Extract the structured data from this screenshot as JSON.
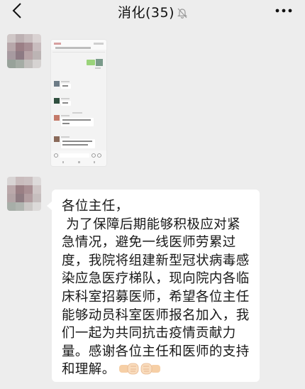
{
  "header": {
    "title": "消化(35)"
  },
  "messages": [
    {
      "type": "image",
      "content": "chat-screenshot-thumbnail"
    },
    {
      "type": "text",
      "text": "各位主任，\n 为了保障后期能够积极应对紧急情况，避免一线医师劳累过度，我院将组建新型冠状病毒感染应急医疗梯队，现向院内各临床科室招募医师，希望各位主任能够动员科室医师报名加入，我们一起为共同抗击疫情贡献力量。感谢各位主任和医师的支持和理解。",
      "emoji": "fist-bump-emoji"
    }
  ],
  "icons": {
    "back": "chevron-left-icon",
    "mute": "bell-off-icon",
    "more": "more-dots-icon"
  }
}
